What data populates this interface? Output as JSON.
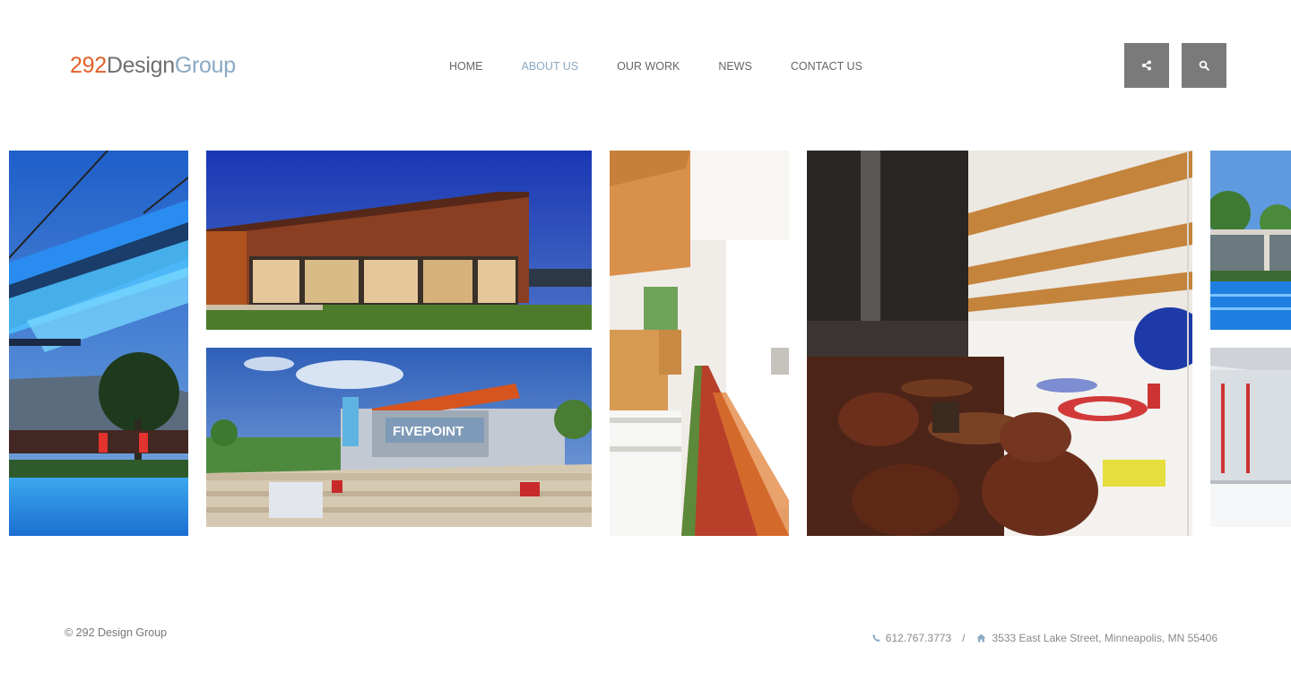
{
  "header": {
    "logo": {
      "part1": "292",
      "part2": "Design",
      "part3": "Group"
    },
    "nav": [
      {
        "label": "HOME",
        "active": false
      },
      {
        "label": "ABOUT US",
        "active": true
      },
      {
        "label": "OUR WORK",
        "active": false
      },
      {
        "label": "NEWS",
        "active": false
      },
      {
        "label": "CONTACT US",
        "active": false
      }
    ],
    "share_icon": "share-icon",
    "search_icon": "search-icon",
    "button_color": "#7a7a7a"
  },
  "gallery": {
    "tiles": [
      {
        "name": "project-tile-pool-pavilion"
      },
      {
        "name": "project-tile-building-dusk"
      },
      {
        "name": "project-tile-fivepoint-plaza",
        "sign_text": "FIVEPOINT"
      },
      {
        "name": "project-tile-office-corridor"
      },
      {
        "name": "project-tile-curling-lounge"
      },
      {
        "name": "project-tile-pool-partial"
      },
      {
        "name": "project-tile-interior-partial"
      }
    ]
  },
  "footer": {
    "copyright": "© 292 Design Group",
    "phone_icon": "phone-icon",
    "phone": "612.767.3773",
    "separator": "/",
    "home_icon": "home-icon",
    "address": "3533 East Lake Street, Minneapolis, MN 55406"
  },
  "colors": {
    "brand_orange": "#e0602a",
    "brand_blue": "#8aa9c4",
    "text_gray": "#666666"
  }
}
